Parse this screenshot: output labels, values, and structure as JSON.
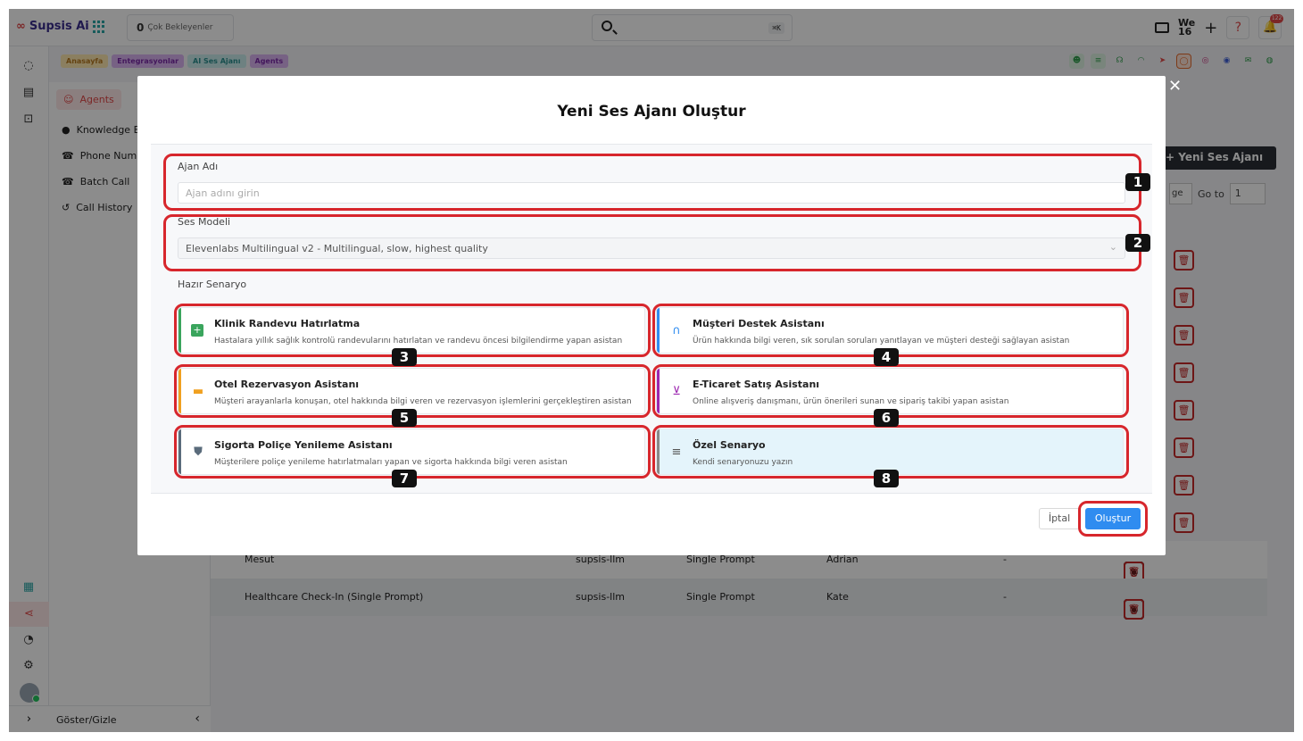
{
  "app": {
    "name": "Supsis Ai"
  },
  "topbar": {
    "pending_count": "0",
    "pending_label": "Çok Bekleyenler",
    "search_shortcut": "⌘K",
    "workspace_top": "We",
    "workspace_bottom": "16",
    "notification_count": "122"
  },
  "breadcrumbs": [
    {
      "label": "Anasayfa",
      "bg": "#fde7b0",
      "color": "#b7791f"
    },
    {
      "label": "Entegrasyonlar",
      "bg": "#d9b3f0",
      "color": "#7b2aa8"
    },
    {
      "label": "AI Ses Ajanı",
      "bg": "#c8ecec",
      "color": "#2b8f8f"
    },
    {
      "label": "Agents",
      "bg": "#d9b3f0",
      "color": "#7b2aa8"
    }
  ],
  "sidebar": {
    "items": [
      {
        "label": "Agents",
        "icon": "agent-icon"
      },
      {
        "label": "Knowledge B",
        "icon": "knowledge-icon"
      },
      {
        "label": "Phone Numb",
        "icon": "phone-icon"
      },
      {
        "label": "Batch Call",
        "icon": "phone-icon"
      },
      {
        "label": "Call History",
        "icon": "history-icon"
      }
    ],
    "footer_label": "Göster/Gizle"
  },
  "background": {
    "new_button": "Yeni Ses Ajanı",
    "goto_label": "Go to",
    "goto_value": "1",
    "page_select": "ge",
    "rows": [
      {
        "name": "Mesut",
        "llm": "supsis-llm",
        "type": "Single Prompt",
        "voice": "Adrian",
        "extra": "-"
      },
      {
        "name": "Healthcare Check-In (Single Prompt)",
        "llm": "supsis-llm",
        "type": "Single Prompt",
        "voice": "Kate",
        "extra": "-"
      }
    ]
  },
  "modal": {
    "title": "Yeni Ses Ajanı Oluştur",
    "agent_name_label": "Ajan Adı",
    "agent_name_placeholder": "Ajan adını girin",
    "voice_model_label": "Ses Modeli",
    "voice_model_value": "Elevenlabs Multilingual v2 - Multilingual, slow, highest quality",
    "scenario_label": "Hazır Senaryo",
    "scenarios": [
      {
        "title": "Klinik Randevu Hatırlatma",
        "desc": "Hastalara yıllık sağlık kontrolü randevularını hatırlatan ve randevu öncesi bilgilendirme yapan asistan",
        "accent": "#3aa55d",
        "icon": "plus-square-icon"
      },
      {
        "title": "Müşteri Destek Asistanı",
        "desc": "Ürün hakkında bilgi veren, sık sorulan soruları yanıtlayan ve müşteri desteği sağlayan asistan",
        "accent": "#2f8cf0",
        "icon": "headset-icon"
      },
      {
        "title": "Otel Rezervasyon Asistanı",
        "desc": "Müşteri arayanlarla konuşan, otel hakkında bilgi veren ve rezervasyon işlemlerini gerçekleştiren asistan",
        "accent": "#f0a020",
        "icon": "bed-icon"
      },
      {
        "title": "E-Ticaret Satış Asistanı",
        "desc": "Online alışveriş danışmanı, ürün önerileri sunan ve sipariş takibi yapan asistan",
        "accent": "#9c27b0",
        "icon": "cart-icon"
      },
      {
        "title": "Sigorta Poliçe Yenileme Asistanı",
        "desc": "Müşterilere poliçe yenileme hatırlatmaları yapan ve sigorta hakkında bilgi veren asistan",
        "accent": "#5a6b7b",
        "icon": "shield-icon"
      },
      {
        "title": "Özel Senaryo",
        "desc": "Kendi senaryonuzu yazın",
        "accent": "#888888",
        "icon": "edit-list-icon"
      }
    ],
    "cancel_label": "İptal",
    "create_label": "Oluştur"
  },
  "annotations": [
    "1",
    "2",
    "3",
    "4",
    "5",
    "6",
    "7",
    "8"
  ]
}
